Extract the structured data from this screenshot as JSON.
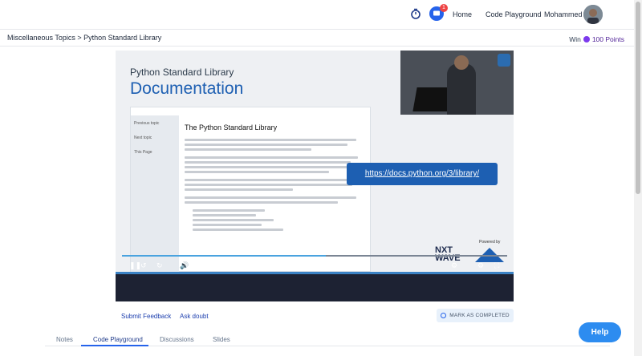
{
  "nav": {
    "chat_badge": "1",
    "links": [
      "Home",
      "Code Playground"
    ],
    "user_name": "Mohammed"
  },
  "breadcrumb": "Miscellaneous Topics > Python Standard Library",
  "win": {
    "label": "Win",
    "points": "100 Points"
  },
  "video": {
    "slide_heading": "Python Standard Library",
    "slide_title": "Documentation",
    "page_title": "The Python Standard Library",
    "sidebar_lines": [
      "Previous topic",
      "Next topic",
      "This Page"
    ],
    "link_text": "https://docs.python.org/3/library/",
    "powered_by": "Powered by",
    "brand": "NXT WAVE",
    "current_time": "24:11",
    "duration": "45:40",
    "progress": 0.53
  },
  "actions": {
    "submit_feedback": "Submit Feedback",
    "ask_doubt": "Ask doubt",
    "mark_completed": "MARK AS COMPLETED"
  },
  "tabs": [
    "Notes",
    "Code Playground",
    "Discussions",
    "Slides"
  ],
  "active_tab": "Code Playground",
  "help": "Help",
  "colors": {
    "accent": "#2563eb",
    "help": "#2d8cf0",
    "points": "#7c3aed"
  }
}
